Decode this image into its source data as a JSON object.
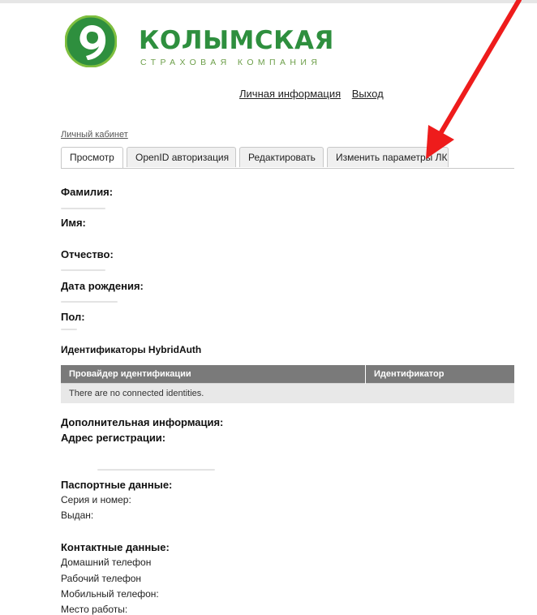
{
  "brand": {
    "name": "КОЛЫМСКАЯ",
    "tagline": "СТРАХОВАЯ КОМПАНИЯ",
    "colors": {
      "primary": "#2e8f3e",
      "secondary": "#6d9f4a"
    },
    "icon": "kolymskaya-logo-icon"
  },
  "top_links": {
    "personal_info": "Личная информация",
    "logout": "Выход"
  },
  "breadcrumb": "Личный кабинет",
  "tabs": [
    {
      "label": "Просмотр",
      "active": true
    },
    {
      "label": "OpenID авторизация",
      "active": false
    },
    {
      "label": "Редактировать",
      "active": false
    },
    {
      "label": "Изменить параметры ЛК",
      "active": false
    }
  ],
  "profile": {
    "surname_label": "Фамилия:",
    "name_label": "Имя:",
    "patronymic_label": "Отчество:",
    "birthdate_label": "Дата рождения:",
    "gender_label": "Пол:"
  },
  "hybridauth": {
    "title": "Идентификаторы HybridAuth",
    "columns": [
      "Провайдер идентификации",
      "Идентификатор"
    ],
    "empty_message": "There are no connected identities."
  },
  "additional": {
    "title": "Дополнительная информация:",
    "address_label": "Адрес регистрации:"
  },
  "passport": {
    "title": "Паспортные данные:",
    "series_label": "Серия и номер:",
    "issued_label": "Выдан:"
  },
  "contacts": {
    "title": "Контактные данные:",
    "home_phone": "Домашний телефон",
    "work_phone": "Рабочий телефон",
    "mobile_phone": "Мобильный телефон:",
    "workplace": "Место работы:"
  },
  "annotation": {
    "color": "#ee1c1c",
    "icon": "red-arrow-annotation"
  }
}
